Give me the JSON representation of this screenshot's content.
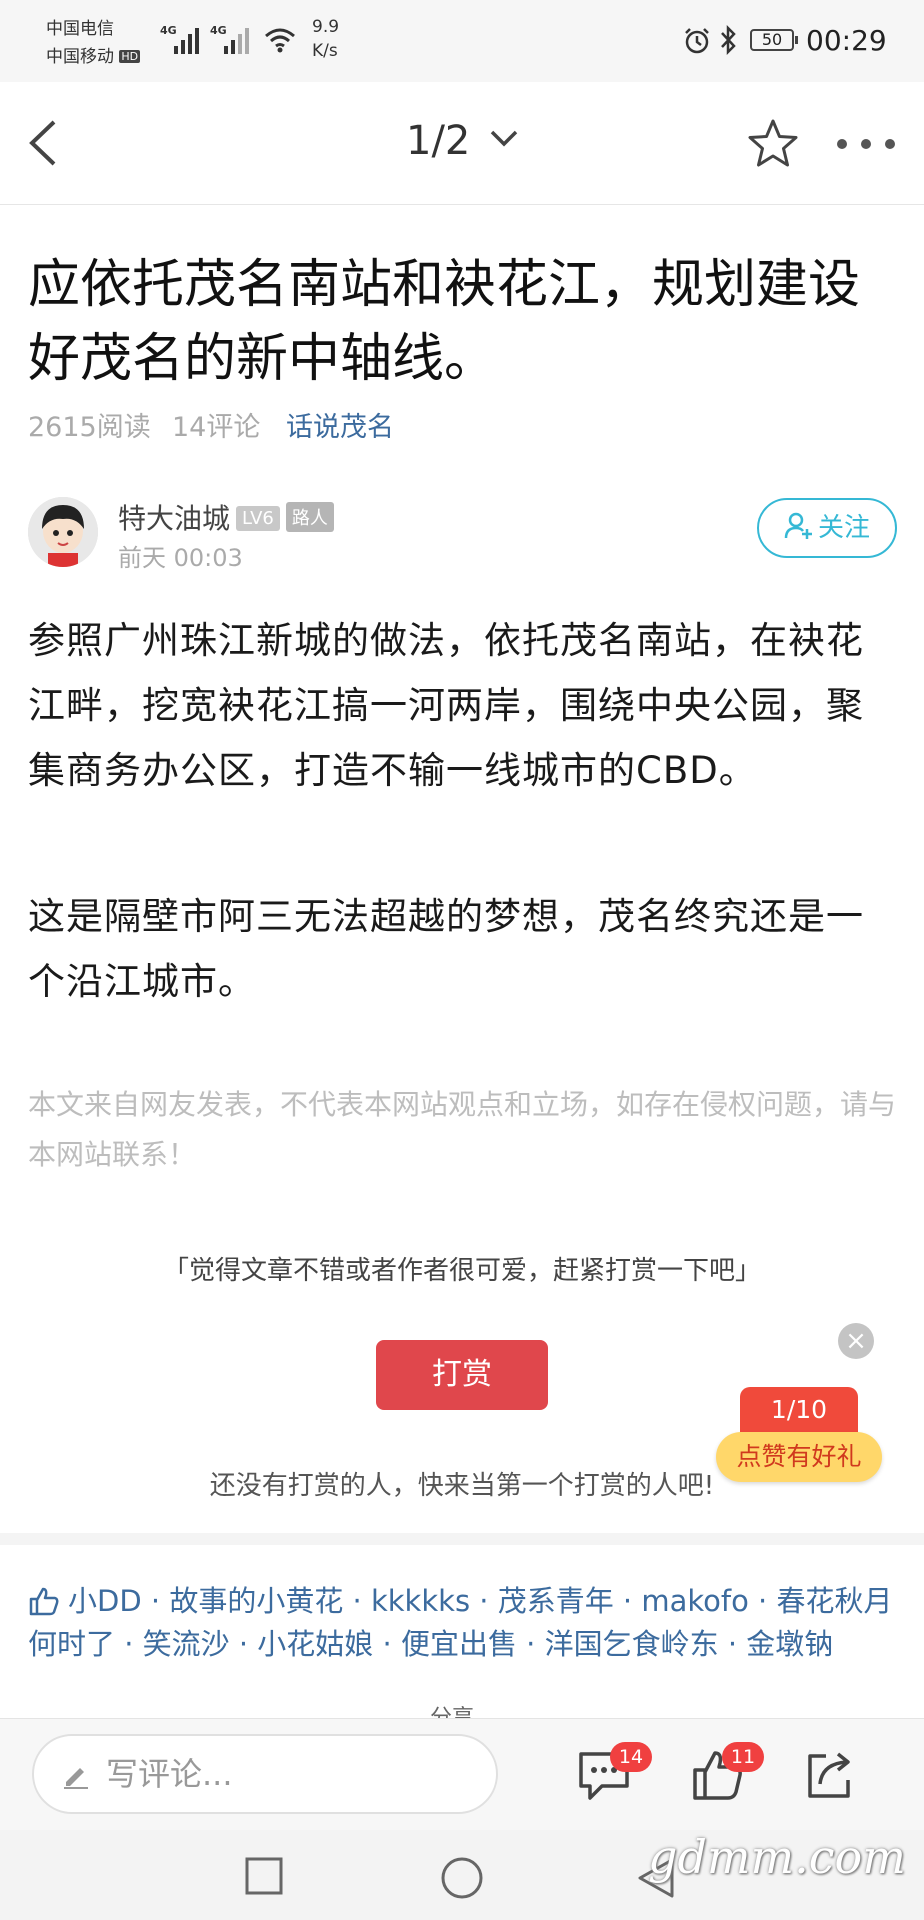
{
  "status_bar": {
    "carrier1": "中国电信",
    "carrier2": "中国移动",
    "hd": "HD",
    "network1": "4G",
    "network2": "4G",
    "speed_value": "9.9",
    "speed_unit": "K/s",
    "battery": "50",
    "time": "00:29"
  },
  "nav": {
    "page_indicator": "1/2"
  },
  "article": {
    "title": "应依托茂名南站和袂花江，规划建设好茂名的新中轴线。",
    "reads": "2615阅读",
    "comments": "14评论",
    "topic": "话说茂名",
    "author": {
      "name": "特大油城",
      "level": "LV6",
      "tag": "路人",
      "time": "前天 00:03",
      "follow_label": "关注"
    },
    "paragraphs": [
      "参照广州珠江新城的做法，依托茂名南站，在袂花江畔，挖宽袂花江搞一河两岸，围绕中央公园，聚集商务办公区，打造不输一线城市的CBD。",
      "这是隔壁市阿三无法超越的梦想，茂名终究还是一个沿江城市。"
    ],
    "disclaimer": "本文来自网友发表，不代表本网站观点和立场，如存在侵权问题，请与本网站联系！"
  },
  "reward": {
    "tip": "「觉得文章不错或者作者很可爱，赶紧打赏一下吧」",
    "button_label": "打赏",
    "note": "还没有打赏的人，快来当第一个打赏的人吧!"
  },
  "promo": {
    "counter": "1/10",
    "label": "点赞有好礼",
    "close": "×"
  },
  "likes": {
    "line1": "小DD · 故事的小黄花 · kkkkks · 茂系青年 · makofo · 春花秋月",
    "line2": "何时了 · 笑流沙 · 小花姑娘 · 便宜出售 · 洋国乞食岭东 · 金墩钠"
  },
  "share_partial": "分享",
  "bottom_bar": {
    "comment_placeholder": "写评论...",
    "comment_count": "14",
    "like_count": "11"
  },
  "watermark": "gdmm.com"
}
